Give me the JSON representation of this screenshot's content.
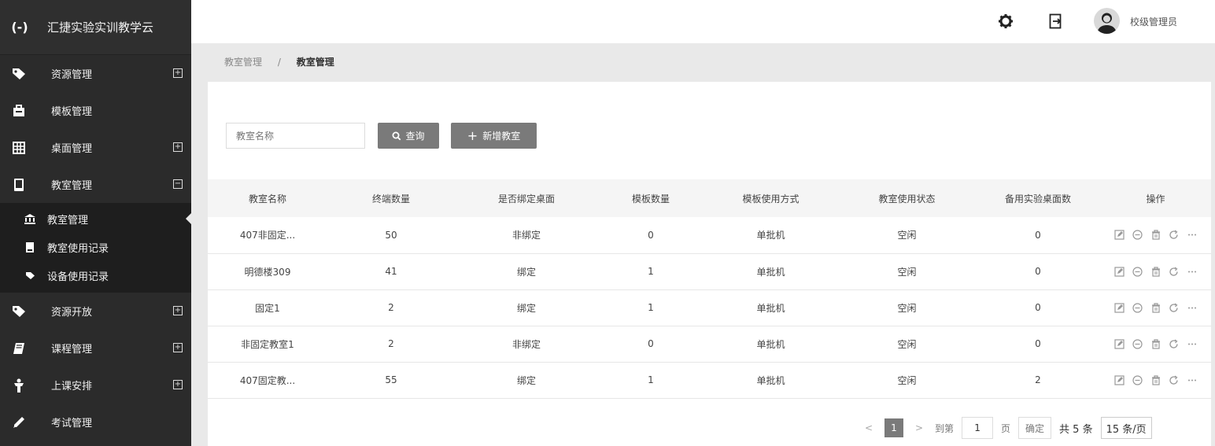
{
  "brand": {
    "logo": "(-)",
    "title": "汇捷实验实训教学云"
  },
  "sidebar": {
    "items": [
      {
        "label": "资源管理",
        "icon": "tag-icon",
        "toggle": "+"
      },
      {
        "label": "模板管理",
        "icon": "briefcase-icon"
      },
      {
        "label": "桌面管理",
        "icon": "grid-icon",
        "toggle": "+"
      },
      {
        "label": "教室管理",
        "icon": "tablet-icon",
        "toggle": "−"
      }
    ],
    "submenu": [
      {
        "label": "教室管理",
        "icon": "bank-icon"
      },
      {
        "label": "教室使用记录",
        "icon": "document-icon"
      },
      {
        "label": "设备使用记录",
        "icon": "tag-icon"
      }
    ],
    "items2": [
      {
        "label": "资源开放",
        "icon": "tag-icon",
        "toggle": "+"
      },
      {
        "label": "课程管理",
        "icon": "book-icon",
        "toggle": "+"
      },
      {
        "label": "上课安排",
        "icon": "person-icon",
        "toggle": "+"
      },
      {
        "label": "考试管理",
        "icon": "pencil-icon"
      }
    ]
  },
  "topbar": {
    "user_name": "校级管理员"
  },
  "breadcrumb": {
    "parent": "教室管理",
    "separator": "/",
    "current": "教室管理"
  },
  "toolbar": {
    "search_placeholder": "教室名称",
    "search_label": "查询",
    "add_label": "新增教室"
  },
  "table": {
    "headers": [
      "教室名称",
      "终端数量",
      "是否绑定桌面",
      "模板数量",
      "模板使用方式",
      "教室使用状态",
      "备用实验桌面数",
      "操作"
    ],
    "rows": [
      [
        "407非固定...",
        "50",
        "非绑定",
        "0",
        "单批机",
        "空闲",
        "0"
      ],
      [
        "明德楼309",
        "41",
        "绑定",
        "1",
        "单批机",
        "空闲",
        "0"
      ],
      [
        "固定1",
        "2",
        "绑定",
        "1",
        "单批机",
        "空闲",
        "0"
      ],
      [
        "非固定教室1",
        "2",
        "非绑定",
        "0",
        "单批机",
        "空闲",
        "0"
      ],
      [
        "407固定教...",
        "55",
        "绑定",
        "1",
        "单批机",
        "空闲",
        "2"
      ]
    ]
  },
  "pagination": {
    "prev": "<",
    "current_page": "1",
    "next": ">",
    "goto_prefix": "到第",
    "goto_value": "1",
    "goto_suffix": "页",
    "confirm": "确定",
    "total": "共 5 条",
    "page_size": "15 条/页"
  }
}
